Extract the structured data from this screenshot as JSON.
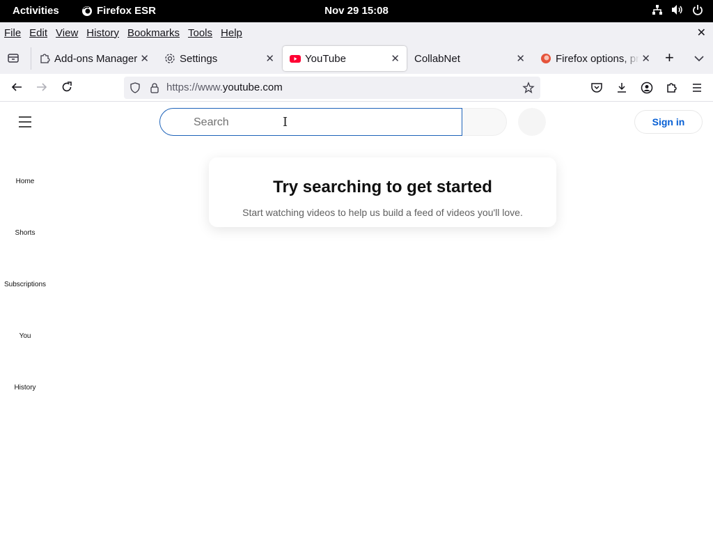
{
  "topbar": {
    "activities": "Activities",
    "app_name": "Firefox ESR",
    "clock": "Nov 29  15:08"
  },
  "menubar": {
    "items": [
      "File",
      "Edit",
      "View",
      "History",
      "Bookmarks",
      "Tools",
      "Help"
    ],
    "close": "✕"
  },
  "tabs": [
    {
      "label": "Add-ons Manager",
      "icon": "puzzle-icon",
      "active": false
    },
    {
      "label": "Settings",
      "icon": "gear-icon",
      "active": false
    },
    {
      "label": "YouTube",
      "icon": "youtube-icon",
      "active": true
    },
    {
      "label": "CollabNet",
      "icon": "",
      "active": false
    },
    {
      "label": "Firefox options, pr",
      "icon": "firefox-options-icon",
      "active": false
    }
  ],
  "navbar": {
    "url_prefix": "https://www.",
    "url_domain": "youtube.com"
  },
  "youtube": {
    "search_placeholder": "Search",
    "sign_in": "Sign in",
    "guide": [
      "Home",
      "Shorts",
      "Subscriptions",
      "You",
      "History"
    ],
    "empty_title": "Try searching to get started",
    "empty_subtitle": "Start watching videos to help us build a feed of videos you'll love."
  },
  "colors": {
    "youtube_red": "#ff0033",
    "sign_in_blue": "#065fd4",
    "search_focus": "#1c62b9"
  }
}
